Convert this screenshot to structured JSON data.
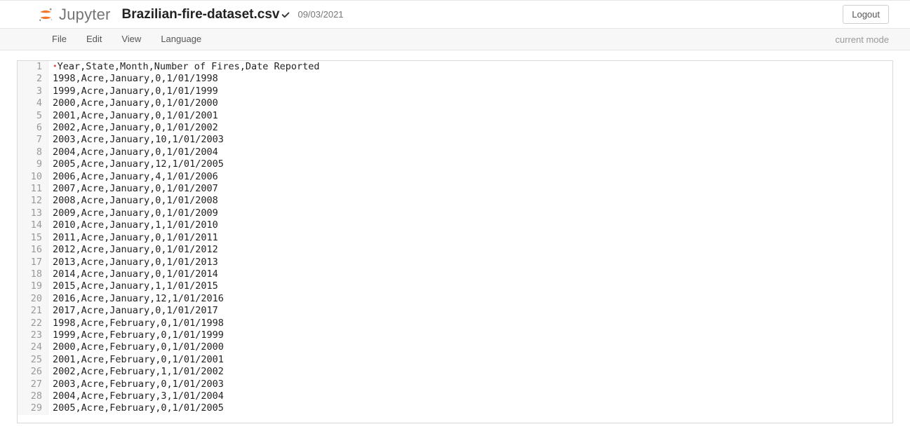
{
  "header": {
    "logo_text": "Jupyter",
    "filename": "Brazilian-fire-dataset.csv",
    "last_modified": "09/03/2021",
    "logout_label": "Logout"
  },
  "menubar": {
    "items": [
      "File",
      "Edit",
      "View",
      "Language"
    ],
    "mode": "current mode"
  },
  "editor": {
    "lines": [
      "Year,State,Month,Number of Fires,Date Reported",
      "1998,Acre,January,0,1/01/1998",
      "1999,Acre,January,0,1/01/1999",
      "2000,Acre,January,0,1/01/2000",
      "2001,Acre,January,0,1/01/2001",
      "2002,Acre,January,0,1/01/2002",
      "2003,Acre,January,10,1/01/2003",
      "2004,Acre,January,0,1/01/2004",
      "2005,Acre,January,12,1/01/2005",
      "2006,Acre,January,4,1/01/2006",
      "2007,Acre,January,0,1/01/2007",
      "2008,Acre,January,0,1/01/2008",
      "2009,Acre,January,0,1/01/2009",
      "2010,Acre,January,1,1/01/2010",
      "2011,Acre,January,0,1/01/2011",
      "2012,Acre,January,0,1/01/2012",
      "2013,Acre,January,0,1/01/2013",
      "2014,Acre,January,0,1/01/2014",
      "2015,Acre,January,1,1/01/2015",
      "2016,Acre,January,12,1/01/2016",
      "2017,Acre,January,0,1/01/2017",
      "1998,Acre,February,0,1/01/1998",
      "1999,Acre,February,0,1/01/1999",
      "2000,Acre,February,0,1/01/2000",
      "2001,Acre,February,0,1/01/2001",
      "2002,Acre,February,1,1/01/2002",
      "2003,Acre,February,0,1/01/2003",
      "2004,Acre,February,3,1/01/2004",
      "2005,Acre,February,0,1/01/2005"
    ]
  }
}
